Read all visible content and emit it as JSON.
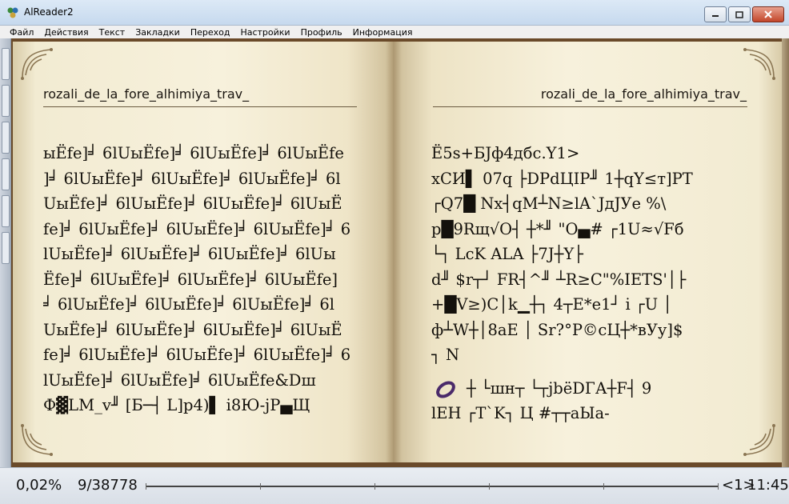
{
  "window": {
    "title": "AlReader2"
  },
  "menu": {
    "items": [
      "Файл",
      "Действия",
      "Текст",
      "Закладки",
      "Переход",
      "Настройки",
      "Профиль",
      "Информация"
    ]
  },
  "book": {
    "left_page": {
      "title": "rozali_de_la_fore_alhimiya_trav_",
      "lines": [
        "ыЁfe]╛ 6lUыЁfe]╛ 6lUыЁfe]╛ 6lUыЁfe",
        "]╛ 6lUыЁfe]╛ 6lUыЁfe]╛ 6lUыЁfe]╛ 6l",
        "UыЁfe]╛ 6lUыЁfe]╛ 6lUыЁfe]╛ 6lUыЁ",
        "fe]╛ 6lUыЁfe]╛ 6lUыЁfe]╛ 6lUыЁfe]╛ 6",
        "lUыЁfe]╛ 6lUыЁfe]╛ 6lUыЁfe]╛ 6lUы",
        "Ёfe]╛ 6lUыЁfe]╛ 6lUыЁfe]╛ 6lUыЁfe]",
        "╛ 6lUыЁfe]╛ 6lUыЁfe]╛ 6lUыЁfe]╛ 6l",
        "UыЁfe]╛ 6lUыЁfe]╛ 6lUыЁfe]╛ 6lUыЁ",
        "fe]╛ 6lUыЁfe]╛ 6lUыЁfe]╛ 6lUыЁfe]╛ 6",
        "lUыЁfe]╛ 6lUыЁfe]╛ 6lUыЁfe&Dш",
        "Ф▓LM_v╜ [Б─┤ L]p4)▌ i8Ю-jP▄Щ"
      ]
    },
    "right_page": {
      "title": "rozali_de_la_fore_alhimiya_trav_",
      "lines": [
        "Ё5s+БЈф4дбс.Y1>",
        "хСИ▌ 07q ├DPdЦIP╜ 1┼qY≤т]PT",
        "┌Q7█ Nx┤qM┴N≥lA`JдJУe %\\",
        "p█9Rщ√O┤ ┼*╜ \"O▄# ┌1U≈√Fб",
        "└┐ LcK ALA ├7J┼Y├",
        "d╜ $r┬┘ FR┤^╜ ┴R≥C\"%IETS'│├",
        "+█V≥)C│k▁┼┐ 4┬E*e1┘ i ┌U │",
        "ф┴W┼│8aE │ Sr?°P©сЦ┼*вУу]$",
        "┐ N",
        "┼ └шн┬ └┬jbёDГА┼F┤ 9",
        "lЕН ┌T`K┐ Ц #┬┬аЫа-"
      ]
    }
  },
  "status": {
    "percent": "0,02%",
    "pages": "9/38778",
    "chapter": "<1>",
    "time": "11:45",
    "progress_fraction": 0.0002
  }
}
